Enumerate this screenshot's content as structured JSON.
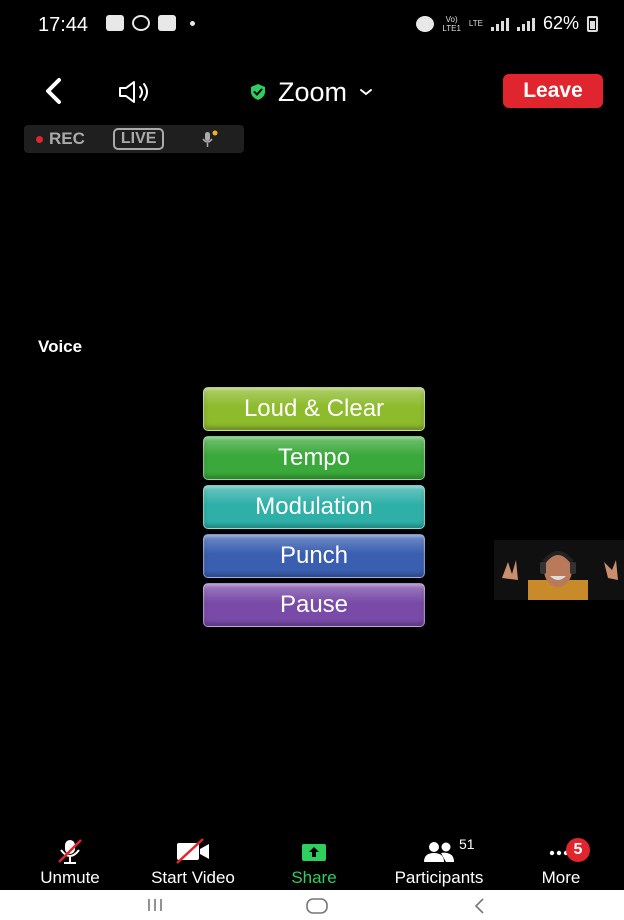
{
  "status_bar": {
    "time": "17:44",
    "battery": "62%",
    "network": "LTE",
    "icons": [
      "gallery-icon",
      "whatsapp-icon",
      "youtube-icon",
      "alarm-icon",
      "volte-icon",
      "signal-icon",
      "battery-icon"
    ]
  },
  "header": {
    "title": "Zoom",
    "leave_label": "Leave",
    "recording_label": "REC",
    "live_label": "LIVE"
  },
  "content": {
    "section_label": "Voice",
    "options": [
      {
        "label": "Loud & Clear",
        "color": "#8dbb2c"
      },
      {
        "label": "Tempo",
        "color": "#3aa83a"
      },
      {
        "label": "Modulation",
        "color": "#2eb0a8"
      },
      {
        "label": "Punch",
        "color": "#3a5fb0"
      },
      {
        "label": "Pause",
        "color": "#7a4aa8"
      }
    ]
  },
  "toolbar": {
    "unmute_label": "Unmute",
    "start_video_label": "Start Video",
    "share_label": "Share",
    "participants_label": "Participants",
    "participants_count": "51",
    "more_label": "More",
    "more_badge": "5"
  },
  "colors": {
    "leave": "#e0252e",
    "share": "#2fcf5f",
    "secure": "#2fcf5f",
    "background": "#000000"
  }
}
